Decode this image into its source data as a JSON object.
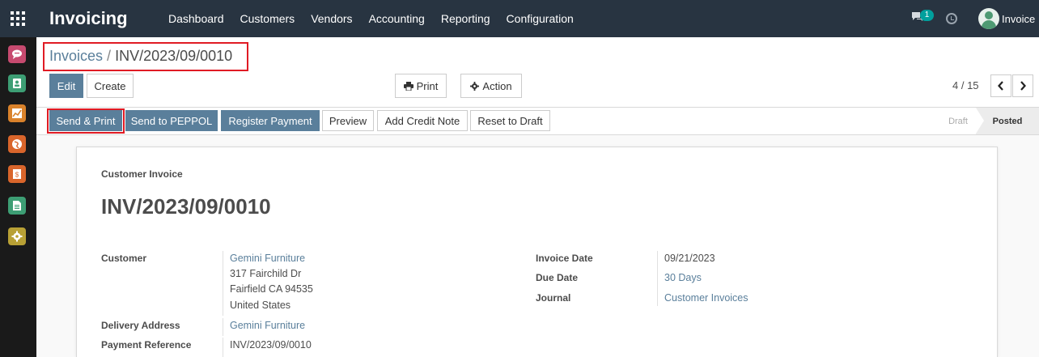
{
  "app": {
    "name": "Invoicing",
    "menu": [
      "Dashboard",
      "Customers",
      "Vendors",
      "Accounting",
      "Reporting",
      "Configuration"
    ],
    "chat_badge": "1",
    "user": "Invoice"
  },
  "sidebar_icons": [
    {
      "icon": "discuss-icon",
      "color": "#c74a6f"
    },
    {
      "icon": "contacts-icon",
      "color": "#3d9e74"
    },
    {
      "icon": "crm-icon",
      "color": "#d9822b"
    },
    {
      "icon": "website-icon",
      "color": "#d9652b"
    },
    {
      "icon": "invoicing-icon",
      "color": "#d9652b"
    },
    {
      "icon": "documents-icon",
      "color": "#3d9e74"
    },
    {
      "icon": "settings-icon",
      "color": "#b8a035"
    }
  ],
  "breadcrumb": {
    "parent": "Invoices",
    "separator": "/",
    "current": "INV/2023/09/0010"
  },
  "buttons": {
    "edit": "Edit",
    "create": "Create",
    "print": "Print",
    "action": "Action"
  },
  "pager": {
    "value": "4 / 15"
  },
  "status_buttons": {
    "send_print": "Send & Print",
    "send_peppol": "Send to PEPPOL",
    "register_payment": "Register Payment",
    "preview": "Preview",
    "add_credit_note": "Add Credit Note",
    "reset_to_draft": "Reset to Draft"
  },
  "stages": {
    "draft": "Draft",
    "posted": "Posted",
    "active": "Posted"
  },
  "invoice": {
    "type": "Customer Invoice",
    "name": "INV/2023/09/0010",
    "customer_label": "Customer",
    "customer_name": "Gemini Furniture",
    "customer_address": [
      "317 Fairchild Dr",
      "Fairfield CA 94535",
      "United States"
    ],
    "delivery_label": "Delivery Address",
    "delivery_value": "Gemini Furniture",
    "payment_ref_label": "Payment Reference",
    "payment_ref_value": "INV/2023/09/0010",
    "invoice_date_label": "Invoice Date",
    "invoice_date_value": "09/21/2023",
    "due_date_label": "Due Date",
    "due_date_value": "30 Days",
    "journal_label": "Journal",
    "journal_value": "Customer Invoices"
  }
}
